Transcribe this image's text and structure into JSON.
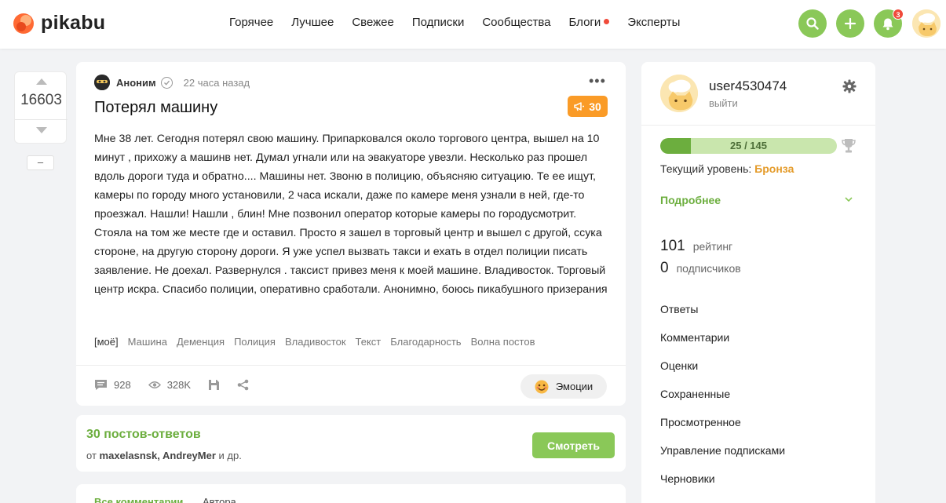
{
  "header": {
    "logo_text": "pikabu",
    "nav": [
      {
        "label": "Горячее"
      },
      {
        "label": "Лучшее"
      },
      {
        "label": "Свежее"
      },
      {
        "label": "Подписки"
      },
      {
        "label": "Сообщества"
      },
      {
        "label": "Блоги"
      },
      {
        "label": "Эксперты"
      }
    ],
    "notification_count": "3",
    "accent_color": "#8ac858"
  },
  "rating": {
    "value": "16603",
    "minus_label": "–"
  },
  "story": {
    "author": "Аноним",
    "time": "22 часа назад",
    "title": "Потерял машину",
    "promo_value": "30",
    "text": "Мне 38 лет. Сегодня потерял свою машину. Припарковался около торгового центра, вышел на 10 минут , прихожу а машинв нет. Думал угнали или на эвакуаторе увезли. Несколько раз прошел вдоль дороги туда и обратно.... Машины нет. Звоню в полицию, объясняю ситуацию. Те ее ищут, камеры по городу много установили, 2 часа искали, даже по камере меня узнали в ней, где-то проезжал. Нашли! Нашли , блин! Мне позвонил оператор которые камеры по городусмотрит. Стояла на том же месте где и оставил. Просто я зашел в торговый центр и вышел с другой, ссука стороне, на другую сторону дороги. Я уже успел вызвать такси и ехать в отдел полиции писать заявление. Не доехал. Развернулся . таксист привез меня к моей машине. Владивосток. Торговый центр искра. Спасибо полиции, оперативно сработали. Анонимно, боюсь пикабушного призерания",
    "tags": [
      "[моё]",
      "Машина",
      "Деменция",
      "Полиция",
      "Владивосток",
      "Текст",
      "Благодарность",
      "Волна постов"
    ],
    "comments_count": "928",
    "views": "328K",
    "emotions_label": "Эмоции"
  },
  "answers": {
    "title": "30 постов-ответов",
    "prefix": "от",
    "authors": "maxelasnsk, AndreyMer",
    "suffix": "и др.",
    "button": "Смотреть"
  },
  "comments": {
    "tab_all": "Все комментарии",
    "tab_author": "Автора"
  },
  "sidebar": {
    "username": "user4530474",
    "logout": "выйти",
    "level_progress": "25 / 145",
    "level_fraction": 0.172,
    "level_label": "Текущий уровень:",
    "level_name": "Бронза",
    "more_label": "Подробнее",
    "rating_value": "101",
    "rating_label": "рейтинг",
    "subs_value": "0",
    "subs_label": "подписчиков",
    "menu": [
      {
        "label": "Ответы"
      },
      {
        "label": "Комментарии"
      },
      {
        "label": "Оценки"
      },
      {
        "label": "Сохраненные"
      },
      {
        "label": "Просмотренное"
      },
      {
        "label": "Управление подписками"
      },
      {
        "label": "Черновики"
      }
    ]
  }
}
